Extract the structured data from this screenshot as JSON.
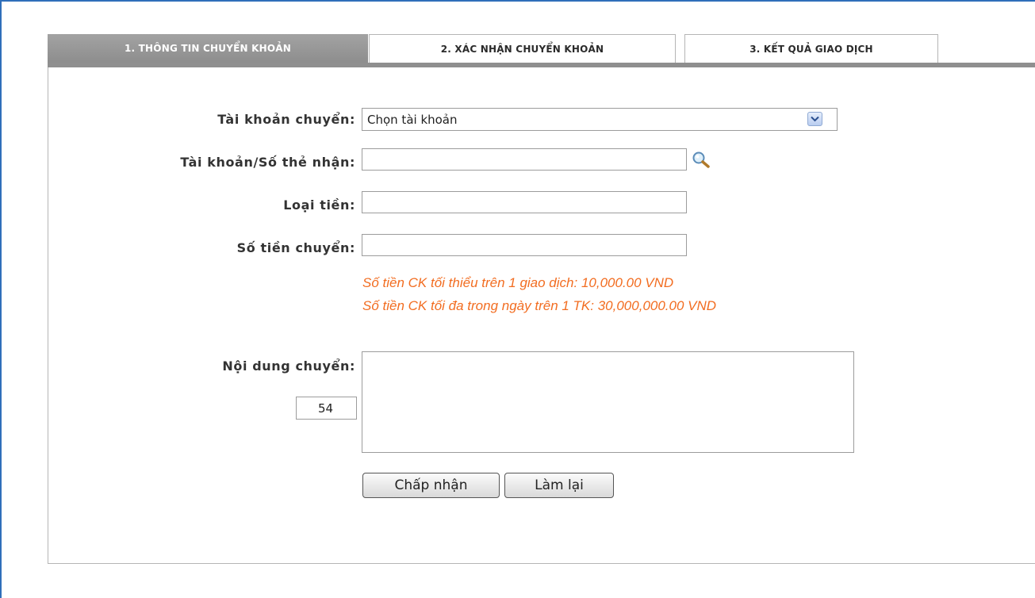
{
  "tabs": [
    {
      "label": "1. THÔNG TIN CHUYỂN KHOẢN",
      "active": true
    },
    {
      "label": "2. XÁC NHẬN CHUYỂN KHOẢN",
      "active": false
    },
    {
      "label": "3. KẾT QUẢ GIAO DỊCH",
      "active": false
    }
  ],
  "form": {
    "source_account_label": "Tài khoản chuyển:",
    "source_account_selected": "Chọn tài khoản",
    "recipient_label": "Tài khoản/Số thẻ nhận:",
    "recipient_value": "",
    "currency_label": "Loại tiền:",
    "currency_value": "",
    "amount_label": "Số tiền chuyển:",
    "amount_value": "",
    "min_hint": "Số tiền CK tối thiểu trên 1 giao dịch: 10,000.00 VND",
    "max_hint": "Số tiền CK tối đa trong ngày trên 1 TK: 30,000,000.00 VND",
    "content_label": "Nội dung chuyển:",
    "content_value": "",
    "char_counter": "54"
  },
  "buttons": {
    "accept": "Chấp nhận",
    "reset": "Làm lại"
  },
  "colors": {
    "hint": "#f26d21",
    "active_tab": "#999999",
    "frame_border": "#2f6fba"
  },
  "icons": {
    "search": "search-icon",
    "dropdown": "chevron-down-icon"
  }
}
